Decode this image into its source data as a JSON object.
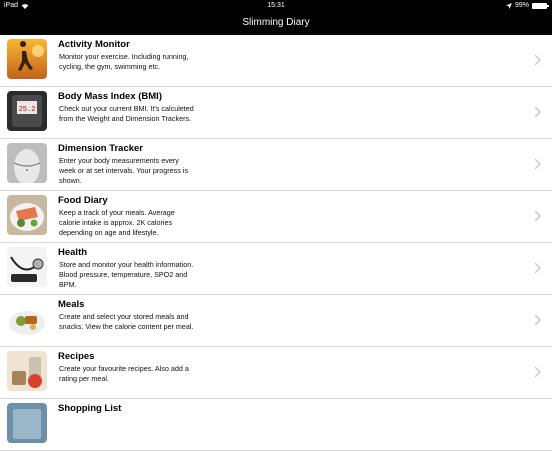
{
  "status_bar": {
    "device": "iPad",
    "time": "15:31",
    "battery_text": "99%",
    "battery_level": 0.99
  },
  "nav": {
    "title": "Slimming Diary"
  },
  "items": [
    {
      "title": "Activity Monitor",
      "desc": "Monitor your exercise. Including running, cycling, the gym, swimming etc.",
      "icon": "runner-image"
    },
    {
      "title": "Body Mass Index (BMI)",
      "desc": "Check out your current BMI. It's calculeted from the Weight and Dimension Trackers.",
      "icon": "scale-image",
      "icon_text": "25.2"
    },
    {
      "title": "Dimension Tracker",
      "desc": "Enter your body measurements every week or at set intervals. Your progress is shown.",
      "icon": "body-image"
    },
    {
      "title": "Food Diary",
      "desc": "Keep a track of your meals. Average calorie intake is approx. 2K calories depending on age and lifestyle.",
      "icon": "salmon-plate-image"
    },
    {
      "title": "Health",
      "desc": "Store and monitor your health information. Blood pressure, temperature, SPO2 and BPM.",
      "icon": "stethoscope-image"
    },
    {
      "title": "Meals",
      "desc": "Create and select your stored meals and snacks. View the calorie content per meal.",
      "icon": "meal-plate-image"
    },
    {
      "title": "Recipes",
      "desc": "Create your favourite recipes. Also add a rating per meal.",
      "icon": "kitchen-scale-image"
    },
    {
      "title": "Shopping List",
      "desc": "",
      "icon": "shopping-image"
    }
  ]
}
